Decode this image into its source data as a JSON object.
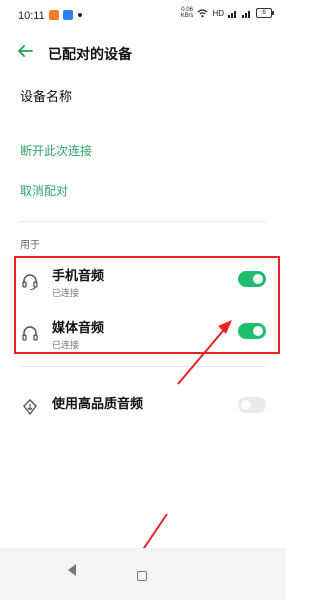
{
  "status_bar": {
    "time": "10:11",
    "speed": "0.06",
    "speed_unit": "KB/s",
    "network": "HD",
    "battery": "6"
  },
  "header": {
    "title": "已配对的设备",
    "back_icon": "arrow-left-icon"
  },
  "device": {
    "name_label": "设备名称"
  },
  "actions": {
    "disconnect": "断开此次连接",
    "unpair": "取消配对"
  },
  "section": {
    "label": "用于"
  },
  "profiles": [
    {
      "title": "手机音频",
      "status": "已连接",
      "enabled": true,
      "icon": "headset-icon"
    },
    {
      "title": "媒体音频",
      "status": "已连接",
      "enabled": true,
      "icon": "headphones-icon"
    }
  ],
  "hq_audio": {
    "title": "使用高品质音频",
    "enabled": false,
    "icon": "audio-quality-icon"
  },
  "colors": {
    "accent": "#1fbd6e",
    "annotation": "#e22222"
  }
}
